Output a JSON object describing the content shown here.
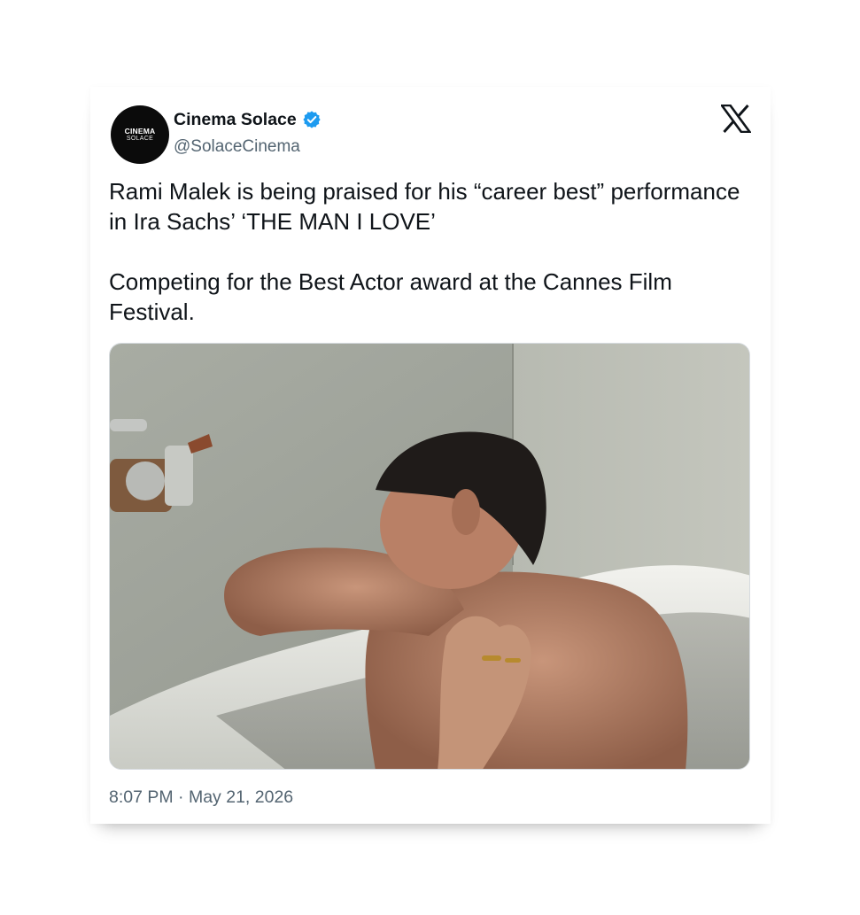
{
  "app": {
    "brand_icon": "x-logo-icon"
  },
  "account": {
    "avatar_line1": "CINEMA",
    "avatar_line2": "SOLACE",
    "display_name": "Cinema Solace",
    "handle": "@SolaceCinema",
    "verified_icon": "verified-badge-icon",
    "verified_color": "#1d9bf0"
  },
  "tweet": {
    "paragraphs": [
      "Rami Malek is being praised for his “career best” performance in Ira Sachs’ ‘THE MAN I LOVE’",
      "Competing for the Best Actor award at the Cannes Film Festival."
    ],
    "time": "8:07 PM",
    "separator": "·",
    "date": "May 21, 2026",
    "media_icon": "photo-icon"
  },
  "colors": {
    "text_primary": "#0f1419",
    "text_secondary": "#536471"
  }
}
